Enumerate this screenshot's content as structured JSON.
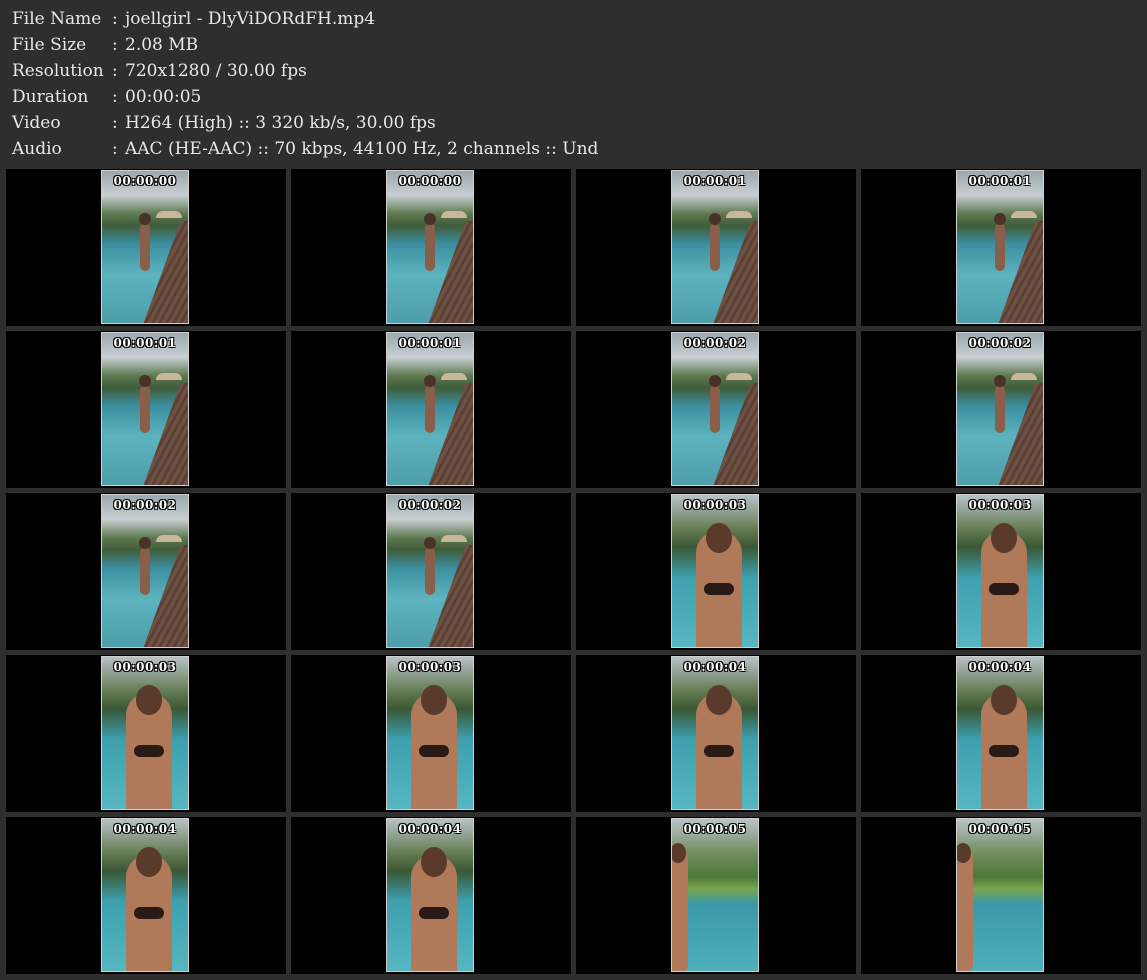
{
  "info": [
    {
      "key": "File Name",
      "value": "joellgirl - DlyViDORdFH.mp4"
    },
    {
      "key": "File Size",
      "value": "2.08 MB"
    },
    {
      "key": "Resolution",
      "value": "720x1280 / 30.00 fps"
    },
    {
      "key": "Duration",
      "value": "00:00:05"
    },
    {
      "key": "Video",
      "value": "H264 (High) :: 3 320 kb/s, 30.00 fps"
    },
    {
      "key": "Audio",
      "value": "AAC (HE-AAC) :: 70 kbps, 44100 Hz, 2 channels :: Und"
    }
  ],
  "separator": ":",
  "thumbnails": [
    {
      "time": "00:00:00",
      "scene": "deck"
    },
    {
      "time": "00:00:00",
      "scene": "deck"
    },
    {
      "time": "00:00:01",
      "scene": "deck"
    },
    {
      "time": "00:00:01",
      "scene": "deck"
    },
    {
      "time": "00:00:01",
      "scene": "deck"
    },
    {
      "time": "00:00:01",
      "scene": "deck"
    },
    {
      "time": "00:00:02",
      "scene": "deck"
    },
    {
      "time": "00:00:02",
      "scene": "deck"
    },
    {
      "time": "00:00:02",
      "scene": "deck"
    },
    {
      "time": "00:00:02",
      "scene": "deck"
    },
    {
      "time": "00:00:03",
      "scene": "close"
    },
    {
      "time": "00:00:03",
      "scene": "close"
    },
    {
      "time": "00:00:03",
      "scene": "close"
    },
    {
      "time": "00:00:03",
      "scene": "close"
    },
    {
      "time": "00:00:04",
      "scene": "close"
    },
    {
      "time": "00:00:04",
      "scene": "close"
    },
    {
      "time": "00:00:04",
      "scene": "close"
    },
    {
      "time": "00:00:04",
      "scene": "close"
    },
    {
      "time": "00:00:05",
      "scene": "lawn"
    },
    {
      "time": "00:00:05",
      "scene": "lawn"
    }
  ]
}
